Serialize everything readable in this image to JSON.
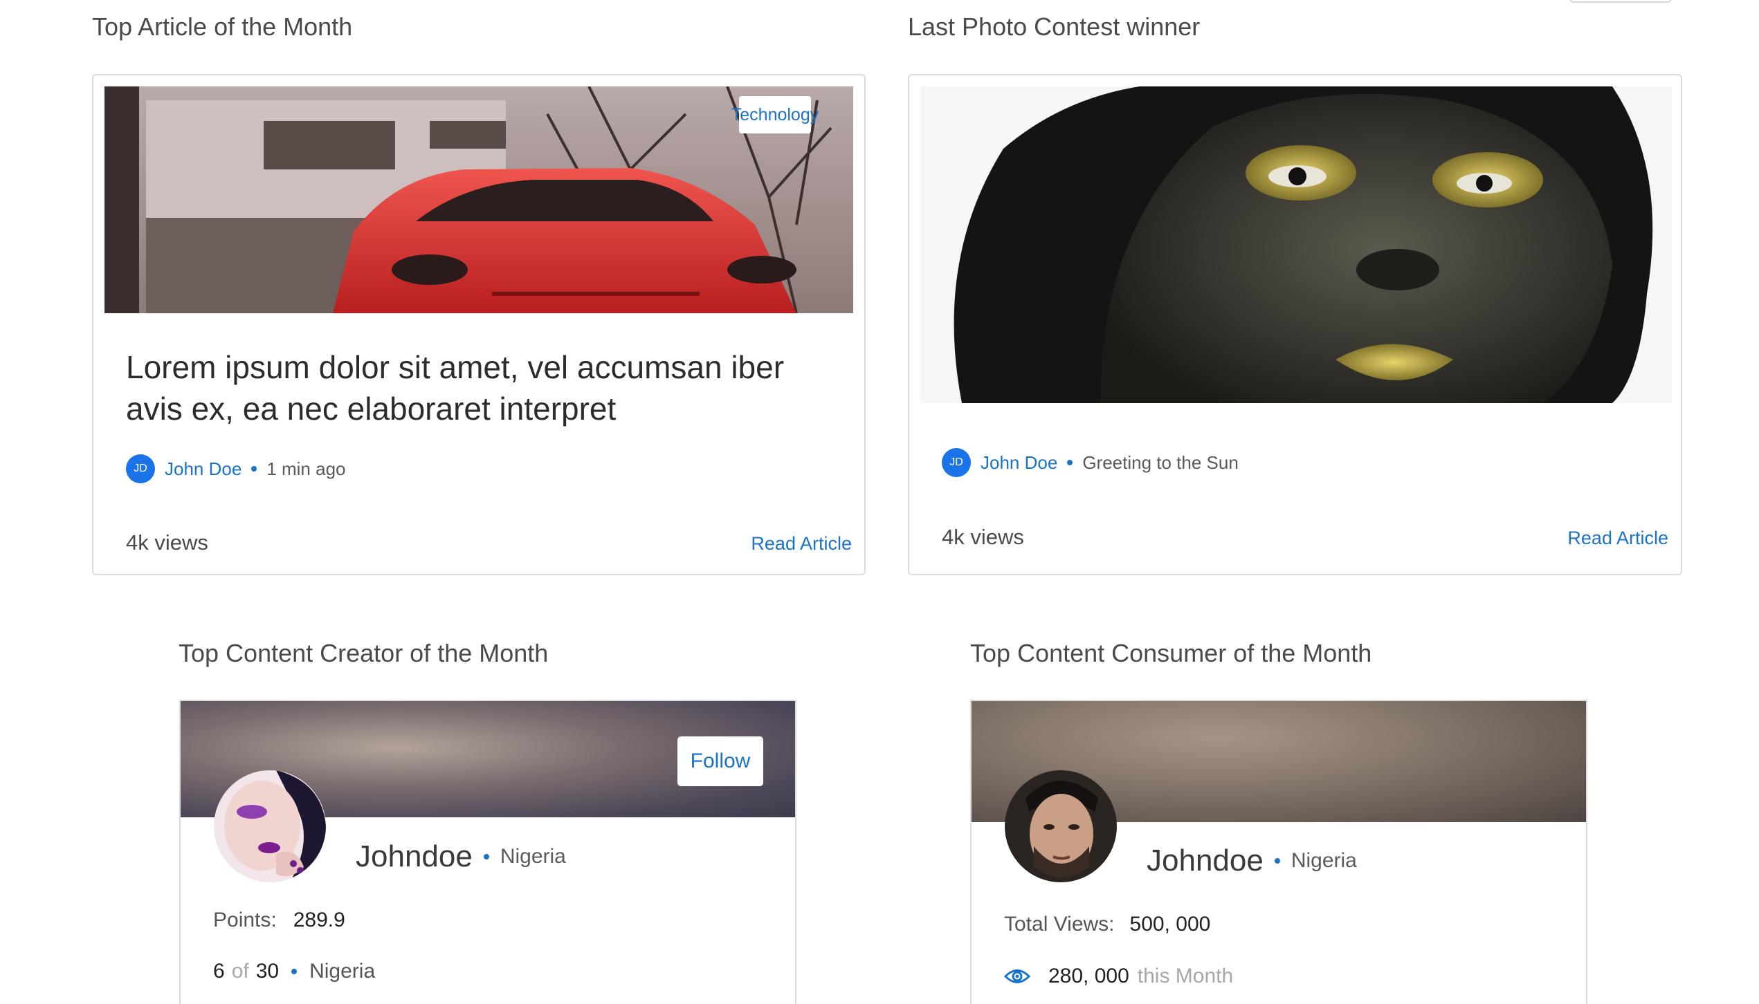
{
  "sections": {
    "top_article": "Top Article of the Month",
    "photo_contest": "Last Photo Contest winner",
    "top_creator": "Top Content Creator of the Month",
    "top_consumer": "Top Content Consumer of the Month"
  },
  "article": {
    "category": "Technology",
    "title": "Lorem ipsum dolor sit amet, vel accumsan iber avis ex, ea nec elaboraret interpret",
    "author_initials": "JD",
    "author": "John Doe",
    "time": "1 min ago",
    "views": "4k views",
    "read_label": "Read Article"
  },
  "photo": {
    "author_initials": "JD",
    "author": "John Doe",
    "caption": "Greeting to the Sun",
    "views": "4k views",
    "read_label": "Read Article"
  },
  "creator": {
    "follow_label": "Follow",
    "username": "Johndoe",
    "country": "Nigeria",
    "points_label": "Points:",
    "points_value": "289.9",
    "rank": "6",
    "rank_of": "of",
    "rank_total": "30",
    "rank_country": "Nigeria"
  },
  "consumer": {
    "username": "Johndoe",
    "country": "Nigeria",
    "total_views_label": "Total Views:",
    "total_views_value": "500, 000",
    "month_views_value": "280, 000",
    "month_views_suffix": "this Month"
  },
  "colors": {
    "accent": "#1a73c9",
    "avatar_badge": "#1a73e8",
    "card_border": "#dcdcdc"
  }
}
